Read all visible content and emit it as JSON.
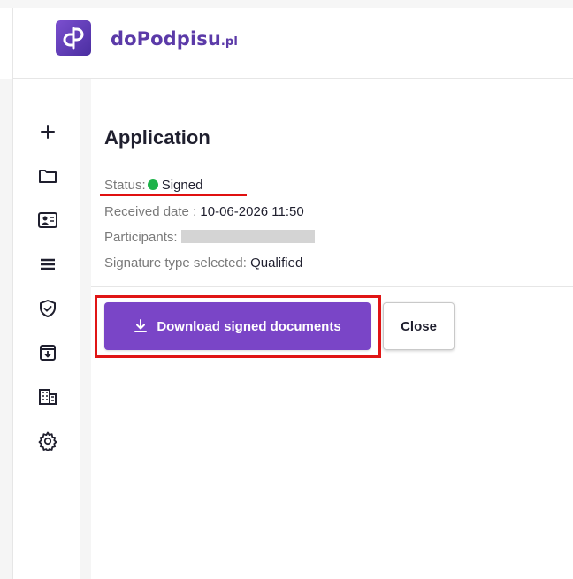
{
  "header": {
    "logo_name": "doPodpisu",
    "logo_suffix": ".pl",
    "brand_color": "#5b3aa8"
  },
  "sidebar": {
    "items": [
      {
        "icon": "plus-icon"
      },
      {
        "icon": "folder-icon"
      },
      {
        "icon": "contact-card-icon"
      },
      {
        "icon": "list-icon"
      },
      {
        "icon": "shield-check-icon"
      },
      {
        "icon": "archive-download-icon"
      },
      {
        "icon": "building-icon"
      },
      {
        "icon": "gear-icon"
      }
    ]
  },
  "main": {
    "title": "Application",
    "status_label": "Status:",
    "status_value": "Signed",
    "status_color": "#1eb34a",
    "received_label": "Received date :",
    "received_value": "10-06-2026 11:50",
    "participants_label": "Participants:",
    "signature_label": "Signature type selected:",
    "signature_value": "Qualified",
    "download_label": "Download signed documents",
    "close_label": "Close",
    "accent_color": "#7a45c7",
    "highlight_color": "#e01515"
  }
}
